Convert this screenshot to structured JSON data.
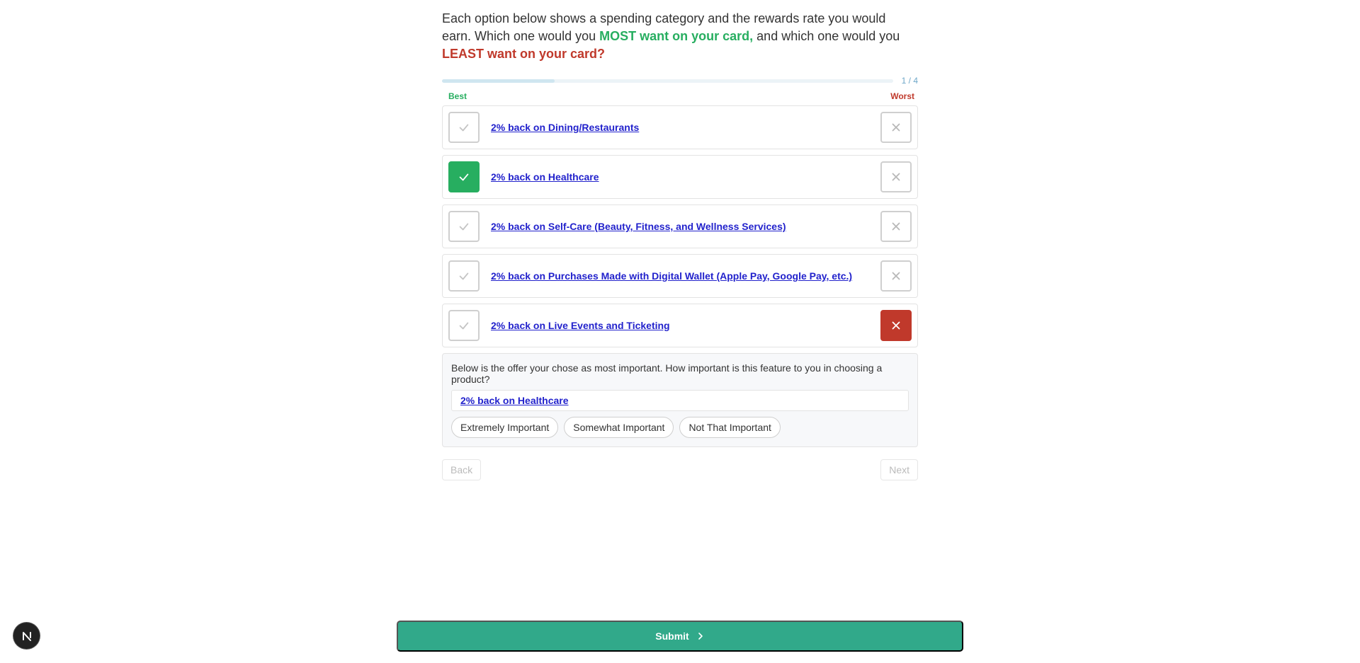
{
  "question": {
    "part1": "Each option below shows a spending category and the rewards rate you would earn. Which one would you ",
    "most": "MOST want on your card,",
    "part2": " and which one would you ",
    "least": "LEAST want on your card?"
  },
  "progress": {
    "text": "1 / 4",
    "fraction": 0.25
  },
  "columns": {
    "best": "Best",
    "worst": "Worst"
  },
  "options": [
    {
      "label": "2% back on Dining/Restaurants",
      "best": false,
      "worst": false
    },
    {
      "label": "2% back on Healthcare",
      "best": true,
      "worst": false
    },
    {
      "label": "2% back on Self-Care (Beauty, Fitness, and Wellness Services)",
      "best": false,
      "worst": false
    },
    {
      "label": "2% back on Purchases Made with Digital Wallet (Apple Pay, Google Pay, etc.)",
      "best": false,
      "worst": false
    },
    {
      "label": "2% back on Live Events and Ticketing",
      "best": false,
      "worst": true
    }
  ],
  "followup": {
    "question": "Below is the offer your chose as most important. How important is this feature to you in choosing a product?",
    "selected_offer": "2% back on Healthcare",
    "choices": [
      "Extremely Important",
      "Somewhat Important",
      "Not That Important"
    ]
  },
  "nav": {
    "back": "Back",
    "next": "Next"
  },
  "submit": {
    "label": "Submit",
    "icon": "chevron-right-icon"
  },
  "colors": {
    "best": "#27ae60",
    "worst": "#c0392b",
    "submit": "#31a98a",
    "link": "#2222cc"
  },
  "corner_logo": {
    "icon": "n-logo-icon"
  }
}
